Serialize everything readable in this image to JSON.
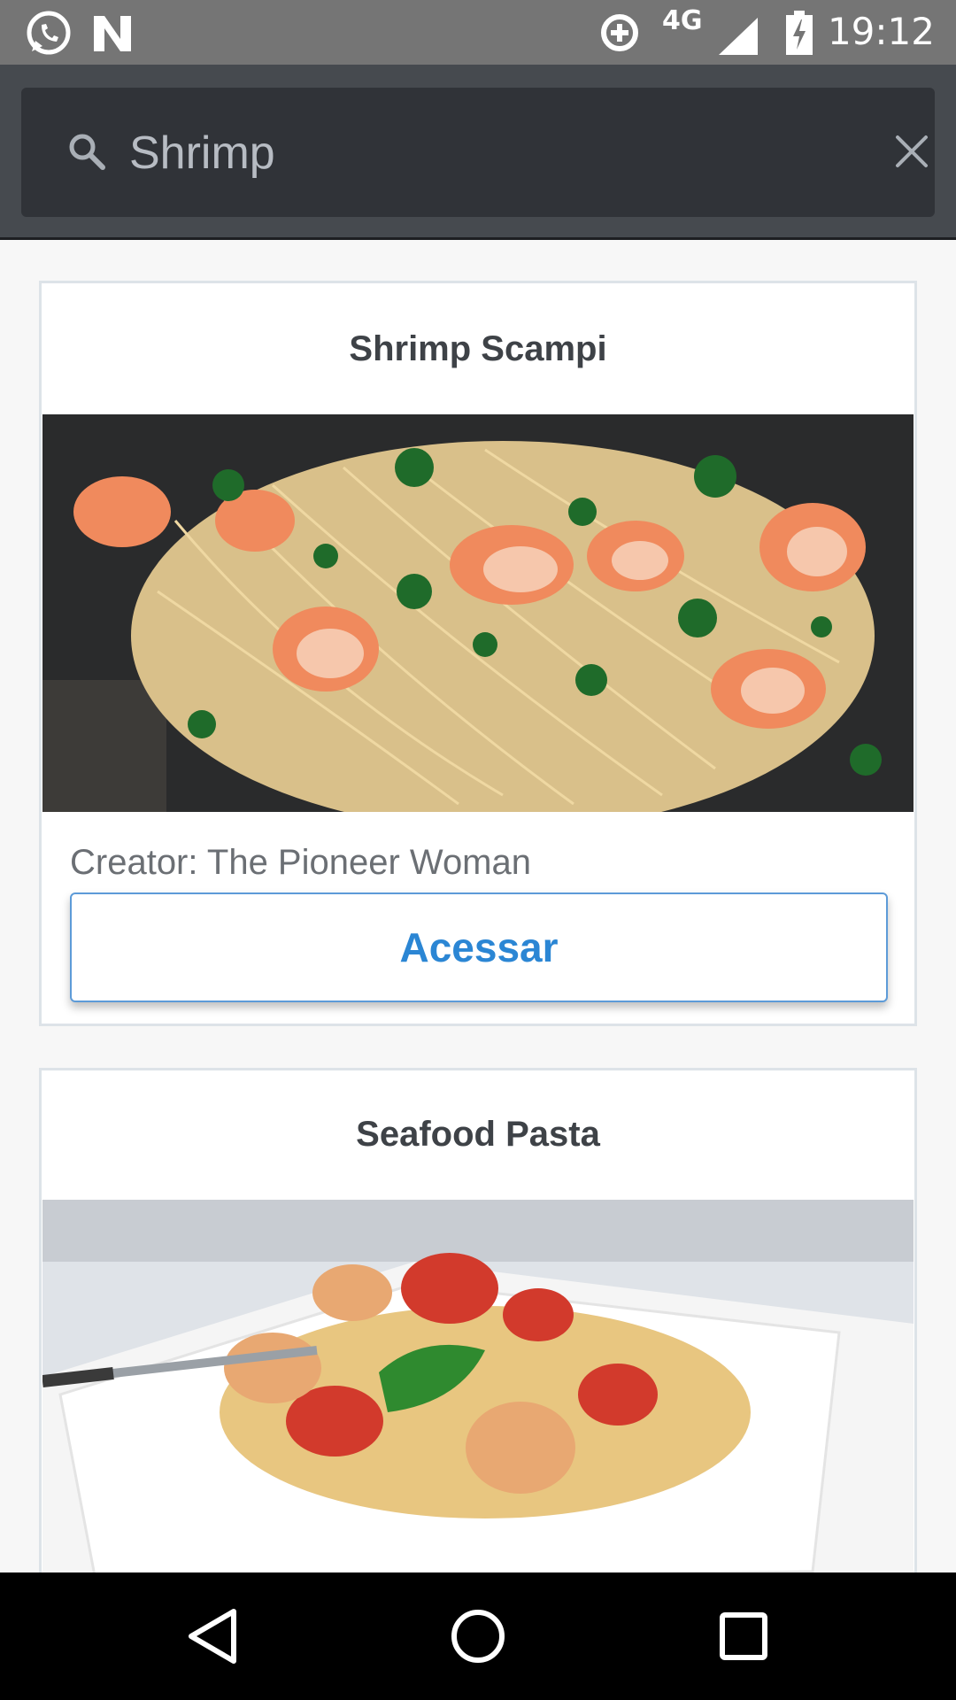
{
  "status_bar": {
    "time": "19:12",
    "network_type": "4G",
    "icons": [
      "whatsapp-icon",
      "n-notification-icon",
      "data-saver-icon",
      "signal-icon",
      "battery-charging-icon"
    ]
  },
  "search": {
    "value": "Shrimp",
    "icon": "search-icon",
    "clear_icon": "close-icon"
  },
  "recipes": [
    {
      "title": "Shrimp Scampi",
      "creator": "Creator: The Pioneer Woman",
      "button_label": "Acessar"
    },
    {
      "title": "Seafood Pasta"
    }
  ],
  "nav_bar": {
    "buttons": [
      "back-icon",
      "home-icon",
      "recents-icon"
    ]
  },
  "colors": {
    "app_bar": "#464a4f",
    "search_box": "#303338",
    "status_bar": "#757575",
    "button_text": "#2b86d4",
    "card_border": "#dde3e8"
  }
}
